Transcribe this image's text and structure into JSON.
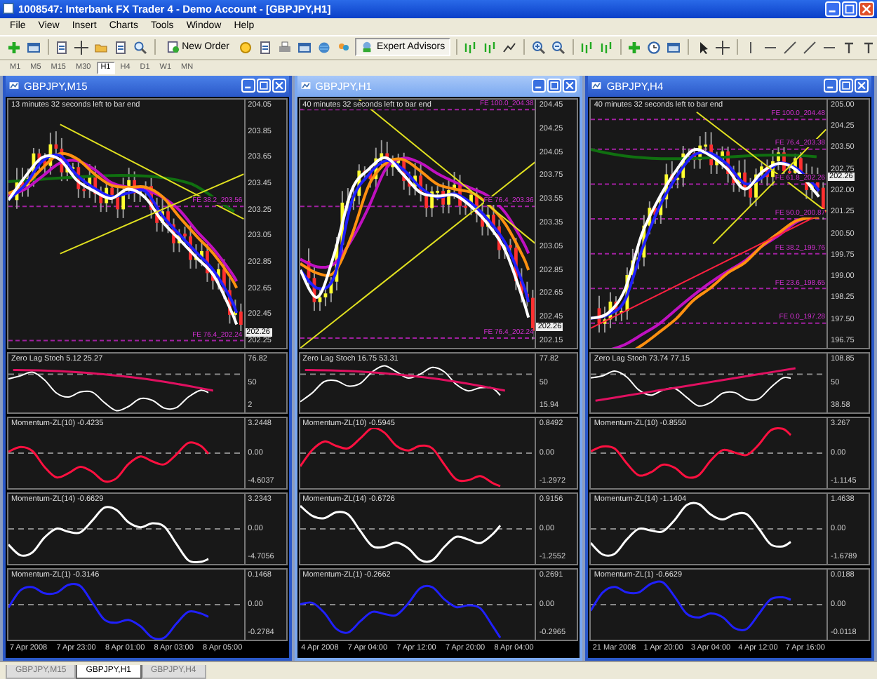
{
  "window": {
    "title": "1008547: Interbank FX Trader 4 - Demo Account - [GBPJPY,H1]"
  },
  "menu": [
    "File",
    "View",
    "Insert",
    "Charts",
    "Tools",
    "Window",
    "Help"
  ],
  "toolbar": {
    "buttons": [
      {
        "label": "New Order"
      },
      {
        "label": "Expert Advisors"
      }
    ]
  },
  "timeframes": [
    {
      "label": "M1",
      "selected": false
    },
    {
      "label": "M5",
      "selected": false
    },
    {
      "label": "M15",
      "selected": false
    },
    {
      "label": "M30",
      "selected": false
    },
    {
      "label": "H1",
      "selected": true
    },
    {
      "label": "H4",
      "selected": false
    },
    {
      "label": "D1",
      "selected": false
    },
    {
      "label": "W1",
      "selected": false
    },
    {
      "label": "MN",
      "selected": false
    }
  ],
  "charts": [
    {
      "title": "GBPJPY,M15",
      "active": false,
      "countdown": "13 minutes 32 seconds left to bar end",
      "price_axis": [
        "204.05",
        "203.85",
        "203.65",
        "203.45",
        "203.25",
        "203.05",
        "202.85",
        "202.65",
        "202.45",
        "202.25"
      ],
      "price_tag": "202.26",
      "fe_levels": [
        "FE 38.2_203.56",
        "FE 76.4_202.24"
      ],
      "panes": [
        {
          "kind": "stoch",
          "label": "Zero Lag Stoch 5.12 25.27",
          "axis": [
            "76.82",
            "50",
            "2"
          ]
        },
        {
          "kind": "momentum",
          "label": "Momentum-ZL(10) -0.4235",
          "color": "#ff1040",
          "axis": [
            "3.2448",
            "0.00",
            "-4.6037"
          ]
        },
        {
          "kind": "momentum",
          "label": "Momentum-ZL(14) -0.6629",
          "color": "#ffffff",
          "axis": [
            "3.2343",
            "0.00",
            "-4.7056"
          ]
        },
        {
          "kind": "momentum",
          "label": "Momentum-ZL(1) -0.3146",
          "color": "#2020ff",
          "axis": [
            "0.1468",
            "0.00",
            "-0.2784"
          ]
        }
      ],
      "time_axis": [
        "7 Apr 2008",
        "7 Apr 23:00",
        "8 Apr 01:00",
        "8 Apr 03:00",
        "8 Apr 05:00"
      ]
    },
    {
      "title": "GBPJPY,H1",
      "active": true,
      "countdown": "40 minutes 32 seconds left to bar end",
      "price_axis": [
        "204.45",
        "204.25",
        "204.05",
        "203.75",
        "203.55",
        "203.35",
        "203.05",
        "202.85",
        "202.65",
        "202.45",
        "202.15"
      ],
      "price_tag": "202.26",
      "fe_levels": [
        "FE 100.0_204.38",
        "FE 76.4_203.36",
        "FE 76.4_202.24"
      ],
      "panes": [
        {
          "kind": "stoch",
          "label": "Zero Lag Stoch 16.75 53.31",
          "axis": [
            "77.82",
            "50",
            "15.94"
          ]
        },
        {
          "kind": "momentum",
          "label": "Momentum-ZL(10) -0.5945",
          "color": "#ff1040",
          "axis": [
            "0.8492",
            "0.00",
            "-1.2972"
          ]
        },
        {
          "kind": "momentum",
          "label": "Momentum-ZL(14) -0.6726",
          "color": "#ffffff",
          "axis": [
            "0.9156",
            "0.00",
            "-1.2552"
          ]
        },
        {
          "kind": "momentum",
          "label": "Momentum-ZL(1) -0.2662",
          "color": "#2020ff",
          "axis": [
            "0.2691",
            "0.00",
            "-0.2965"
          ]
        }
      ],
      "time_axis": [
        "4 Apr 2008",
        "7 Apr 04:00",
        "7 Apr 12:00",
        "7 Apr 20:00",
        "8 Apr 04:00"
      ]
    },
    {
      "title": "GBPJPY,H4",
      "active": false,
      "countdown": "40 minutes 32 seconds left to bar end",
      "price_axis": [
        "205.00",
        "204.25",
        "203.50",
        "202.75",
        "202.00",
        "201.25",
        "200.50",
        "199.75",
        "199.00",
        "198.25",
        "197.50",
        "196.75"
      ],
      "price_tag": "202.26",
      "fe_levels": [
        "FE 100.0_204.48",
        "FE 76.4_203.38",
        "FE 61.8_202.26",
        "FE 50.0_200.87",
        "FE 38.2_199.76",
        "FE 23.6_198.65",
        "FE 0.0_197.28"
      ],
      "panes": [
        {
          "kind": "stoch",
          "label": "Zero Lag Stoch 73.74 77.15",
          "axis": [
            "108.85",
            "50",
            "38.58"
          ]
        },
        {
          "kind": "momentum",
          "label": "Momentum-ZL(10) -0.8550",
          "color": "#ff1040",
          "axis": [
            "3.267",
            "0.00",
            "-1.1145"
          ]
        },
        {
          "kind": "momentum",
          "label": "Momentum-ZL(14) -1.1404",
          "color": "#ffffff",
          "axis": [
            "1.4638",
            "0.00",
            "-1.6789"
          ]
        },
        {
          "kind": "momentum",
          "label": "Momentum-ZL(1) -0.6629",
          "color": "#2020ff",
          "axis": [
            "0.0188",
            "0.00",
            "-0.0118"
          ]
        }
      ],
      "time_axis": [
        "21 Mar 2008",
        "1 Apr 20:00",
        "3 Apr 04:00",
        "4 Apr 12:00",
        "7 Apr 16:00"
      ]
    }
  ],
  "tabs": [
    {
      "label": "GBPJPY,M15",
      "selected": false
    },
    {
      "label": "GBPJPY,H1",
      "selected": true
    },
    {
      "label": "GBPJPY,H4",
      "selected": false
    }
  ]
}
